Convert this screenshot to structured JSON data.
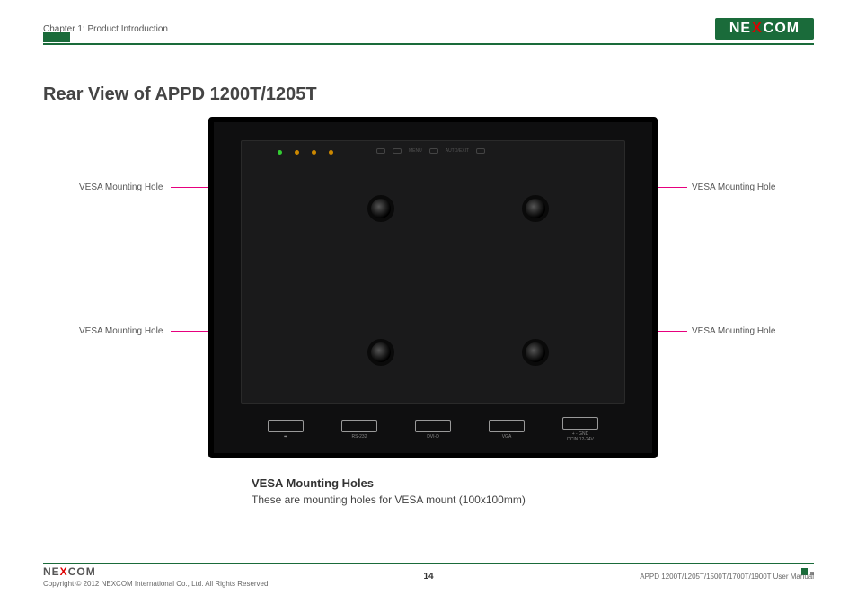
{
  "header": {
    "chapter": "Chapter 1: Product Introduction",
    "brand_pre": "NE",
    "brand_x": "X",
    "brand_post": "COM"
  },
  "title": "Rear View of APPD 1200T/1205T",
  "callouts": {
    "tl": "VESA Mounting Hole",
    "tr": "VESA Mounting Hole",
    "bl": "VESA Mounting Hole",
    "br": "VESA Mounting Hole"
  },
  "ports": {
    "usb": "USB",
    "rs232": "RS-232",
    "dvid": "DVI-D",
    "vga": "VGA",
    "power": "+ - GND\nDCIN 12-24V",
    "menu": "MENU",
    "auto": "AUTO/EXIT"
  },
  "desc": {
    "heading": "VESA Mounting Holes",
    "text": "These are mounting holes for VESA mount (100x100mm)"
  },
  "footer": {
    "copyright": "Copyright © 2012 NEXCOM International Co., Ltd. All Rights Reserved.",
    "page": "14",
    "doc": "APPD 1200T/1205T/1500T/1700T/1900T User Manual"
  }
}
